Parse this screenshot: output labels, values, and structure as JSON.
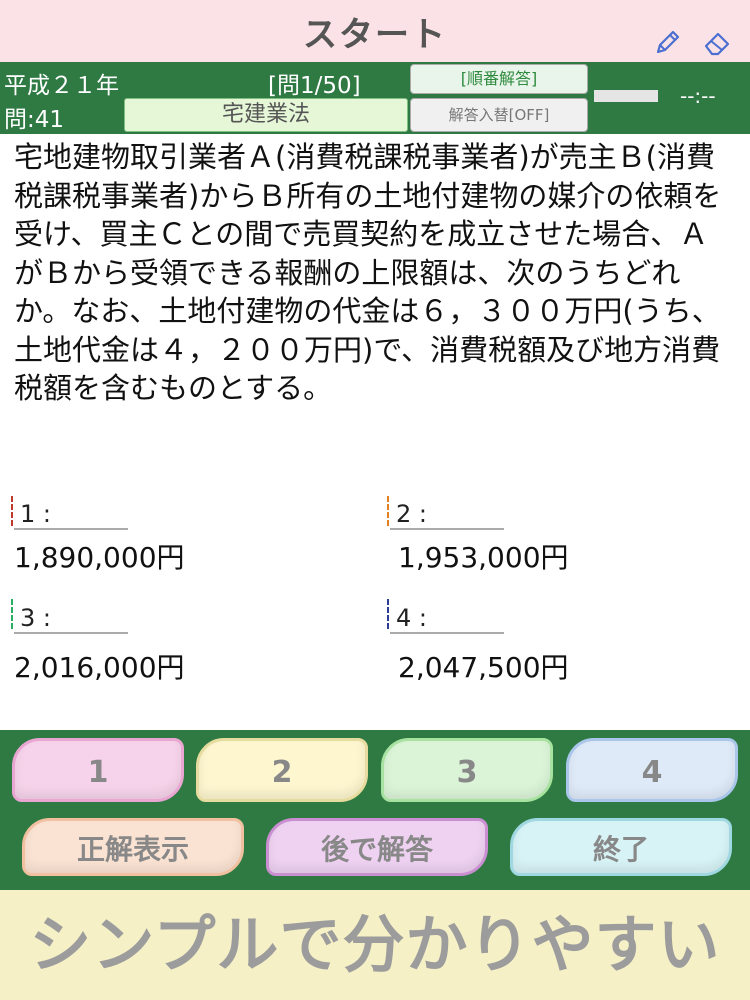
{
  "header": {
    "title": "スタート",
    "colors": {
      "background": "#fbe2e6",
      "title": "#555555",
      "icon": "#4a6fd0"
    }
  },
  "info": {
    "era": "平成２１年",
    "question_number": "問:41",
    "progress": "[問1/50]",
    "order_button": "[順番解答]",
    "category": "宅建業法",
    "swap_button": "解答入替[OFF]",
    "timer": "--:--",
    "colors": {
      "background": "#2f7a43"
    }
  },
  "question": {
    "text": "宅地建物取引業者Ａ(消費税課税事業者)が売主Ｂ(消費税課税事業者)からＢ所有の土地付建物の媒介の依頼を受け、買主Ｃとの間で売買契約を成立させた場合、ＡがＢから受領できる報酬の上限額は、次のうちどれか。なお、土地付建物の代金は６，３００万円(うち、土地代金は４，２００万円)で、消費税額及び地方消費税額を含むものとする。"
  },
  "options": [
    {
      "label": "1 :",
      "value": "1,890,000円"
    },
    {
      "label": "2 :",
      "value": "1,953,000円"
    },
    {
      "label": "3 :",
      "value": "2,016,000円"
    },
    {
      "label": "4 :",
      "value": "2,047,500円"
    }
  ],
  "controls": {
    "answers": [
      "1",
      "2",
      "3",
      "4"
    ],
    "show_answer": "正解表示",
    "answer_later": "後で解答",
    "finish": "終了"
  },
  "banner": {
    "slogan": "シンプルで分かりやすい",
    "colors": {
      "background": "#f6f0c6"
    }
  }
}
